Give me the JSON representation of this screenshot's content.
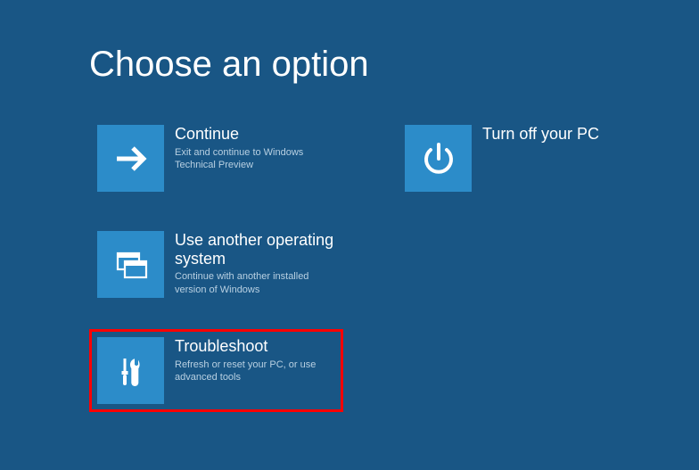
{
  "title": "Choose an option",
  "options": {
    "continue": {
      "title": "Continue",
      "desc": "Exit and continue to Windows Technical Preview"
    },
    "turnoff": {
      "title": "Turn off your PC",
      "desc": ""
    },
    "anotheros": {
      "title": "Use another operating system",
      "desc": "Continue with another installed version of Windows"
    },
    "troubleshoot": {
      "title": "Troubleshoot",
      "desc": "Refresh or reset your PC, or use advanced tools"
    }
  }
}
